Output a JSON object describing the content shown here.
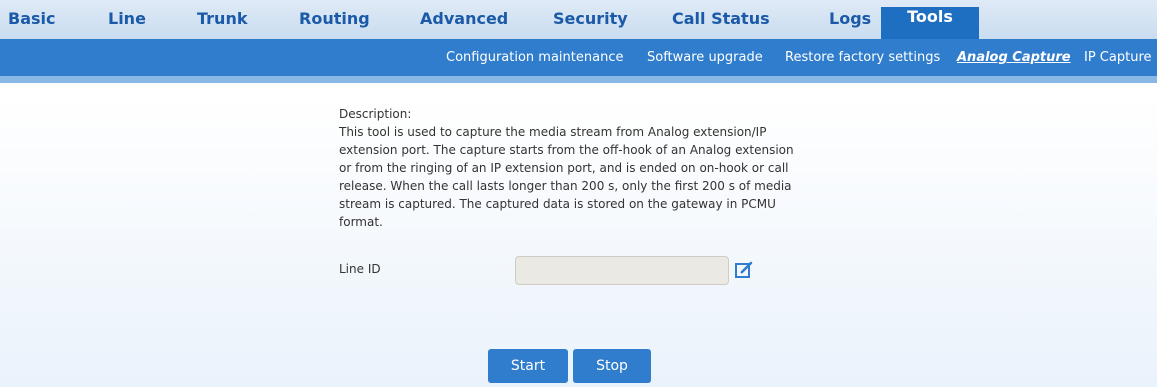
{
  "topnav": {
    "tabs": [
      {
        "label": "Basic"
      },
      {
        "label": "Line"
      },
      {
        "label": "Trunk"
      },
      {
        "label": "Routing"
      },
      {
        "label": "Advanced"
      },
      {
        "label": "Security"
      },
      {
        "label": "Call Status"
      },
      {
        "label": "Logs"
      },
      {
        "label": "Tools",
        "active": true
      }
    ]
  },
  "subnav": {
    "items": [
      {
        "label": "Configuration maintenance"
      },
      {
        "label": "Software upgrade"
      },
      {
        "label": "Restore factory settings"
      },
      {
        "label": "Analog Capture",
        "active": true
      },
      {
        "label": "IP Capture"
      }
    ]
  },
  "content": {
    "description_title": "Description:",
    "description_text": "This tool is used to capture the media stream from Analog extension/IP extension port. The capture starts from the off-hook of an Analog extension or from the ringing of an IP extension port, and is ended on on-hook or call release. When the call lasts longer than 200 s, only the first 200 s of media stream is captured. The captured data is stored on the gateway in PCMU format.",
    "line_id_label": "Line ID",
    "line_id_value": "",
    "start_label": "Start",
    "stop_label": "Stop"
  },
  "colors": {
    "accent": "#2f7dcc",
    "active_tab": "#1e6fc1",
    "tab_text": "#1a5aa8"
  },
  "icons": {
    "edit": "edit-icon"
  }
}
